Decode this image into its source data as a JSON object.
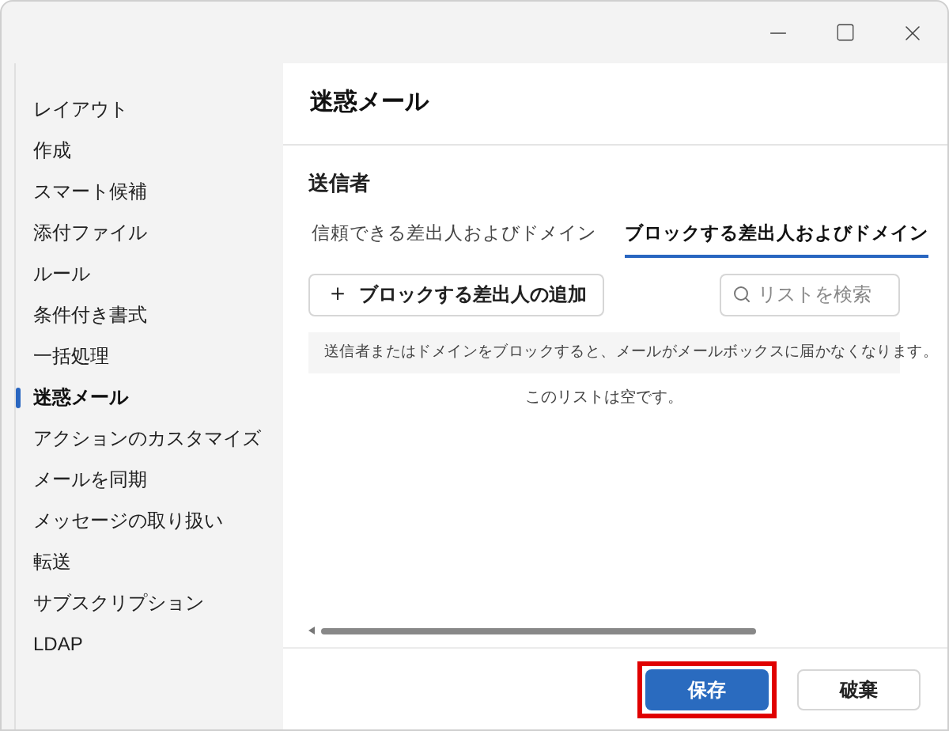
{
  "sidebar": {
    "items": [
      {
        "label": "レイアウト",
        "selected": false
      },
      {
        "label": "作成",
        "selected": false
      },
      {
        "label": "スマート候補",
        "selected": false
      },
      {
        "label": "添付ファイル",
        "selected": false
      },
      {
        "label": "ルール",
        "selected": false
      },
      {
        "label": "条件付き書式",
        "selected": false
      },
      {
        "label": "一括処理",
        "selected": false
      },
      {
        "label": "迷惑メール",
        "selected": true
      },
      {
        "label": "アクションのカスタマイズ",
        "selected": false
      },
      {
        "label": "メールを同期",
        "selected": false
      },
      {
        "label": "メッセージの取り扱い",
        "selected": false
      },
      {
        "label": "転送",
        "selected": false
      },
      {
        "label": "サブスクリプション",
        "selected": false
      },
      {
        "label": "LDAP",
        "selected": false
      }
    ]
  },
  "page": {
    "title": "迷惑メール",
    "section": "送信者",
    "tabs": [
      {
        "label": "信頼できる差出人およびドメイン",
        "selected": false
      },
      {
        "label": "ブロックする差出人およびドメイン",
        "selected": true
      }
    ],
    "add_button": "ブロックする差出人の追加",
    "add_icon": "＋",
    "search": {
      "placeholder": "リストを検索"
    },
    "info": "送信者またはドメインをブロックすると、メールがメールボックスに届かなくなります。",
    "empty": "このリストは空です。"
  },
  "buttons": [
    {
      "label": "保存",
      "kind": "primary",
      "highlighted": true
    },
    {
      "label": "破棄",
      "kind": "secondary",
      "highlighted": false
    }
  ]
}
